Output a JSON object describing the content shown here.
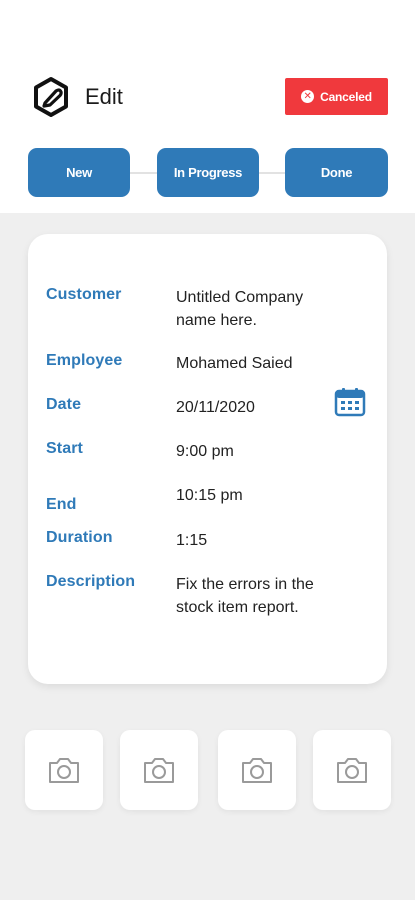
{
  "header": {
    "title": "Edit",
    "status_label": "Canceled",
    "status_color": "#f0393d"
  },
  "steps": [
    {
      "label": "New"
    },
    {
      "label": "In Progress"
    },
    {
      "label": "Done"
    }
  ],
  "details": {
    "customer": {
      "label": "Customer",
      "value": "Untitled Company name here."
    },
    "employee": {
      "label": "Employee",
      "value": "Mohamed Saied"
    },
    "date": {
      "label": "Date",
      "value": "20/11/2020",
      "icon": "calendar-icon"
    },
    "start": {
      "label": "Start",
      "value": "9:00 pm"
    },
    "end": {
      "label": "End",
      "value": "10:15 pm"
    },
    "duration": {
      "label": "Duration",
      "value": "1:15"
    },
    "description": {
      "label": "Description",
      "value": "Fix the errors in the stock item report."
    }
  },
  "photos": [
    {
      "icon": "camera-icon"
    },
    {
      "icon": "camera-icon"
    },
    {
      "icon": "camera-icon"
    },
    {
      "icon": "camera-icon"
    }
  ],
  "colors": {
    "accent": "#2f7ab8",
    "background": "#efefef",
    "card": "#ffffff"
  }
}
